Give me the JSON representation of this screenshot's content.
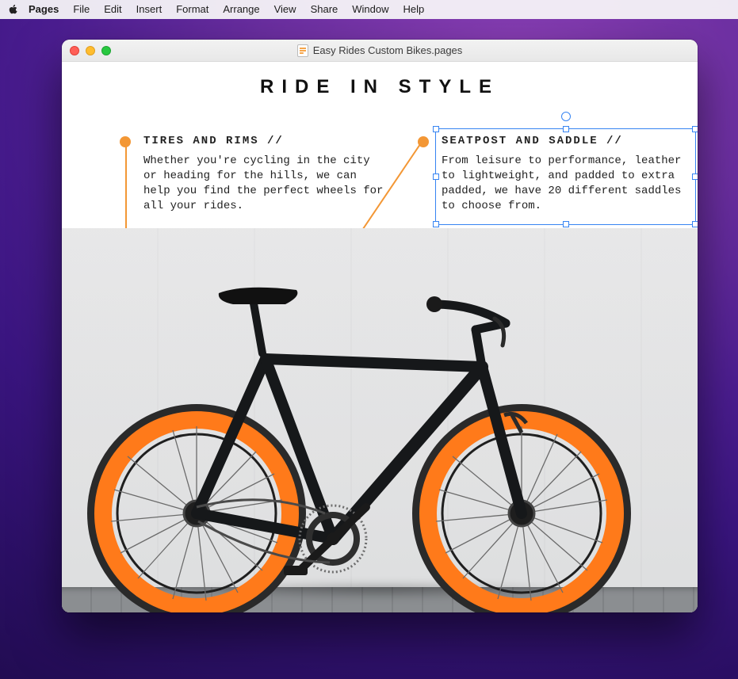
{
  "menubar": {
    "app": "Pages",
    "items": [
      "File",
      "Edit",
      "Insert",
      "Format",
      "Arrange",
      "View",
      "Share",
      "Window",
      "Help"
    ]
  },
  "window": {
    "title": "Easy Rides Custom Bikes.pages"
  },
  "document": {
    "title": "RIDE IN STYLE",
    "callouts": {
      "tires": {
        "heading": "TIRES AND RIMS //",
        "body": "Whether you're cycling in the city or heading for the hills, we can help you find the perfect wheels for all your rides."
      },
      "seatpost": {
        "heading": "SEATPOST AND SADDLE //",
        "body": "From leisure to performance, leather to lightweight, and padded to extra padded, we have 20 different saddles to choose from."
      }
    }
  },
  "colors": {
    "accent": "#f39735",
    "rim": "#ff7a1a",
    "selection": "#3684f2"
  }
}
